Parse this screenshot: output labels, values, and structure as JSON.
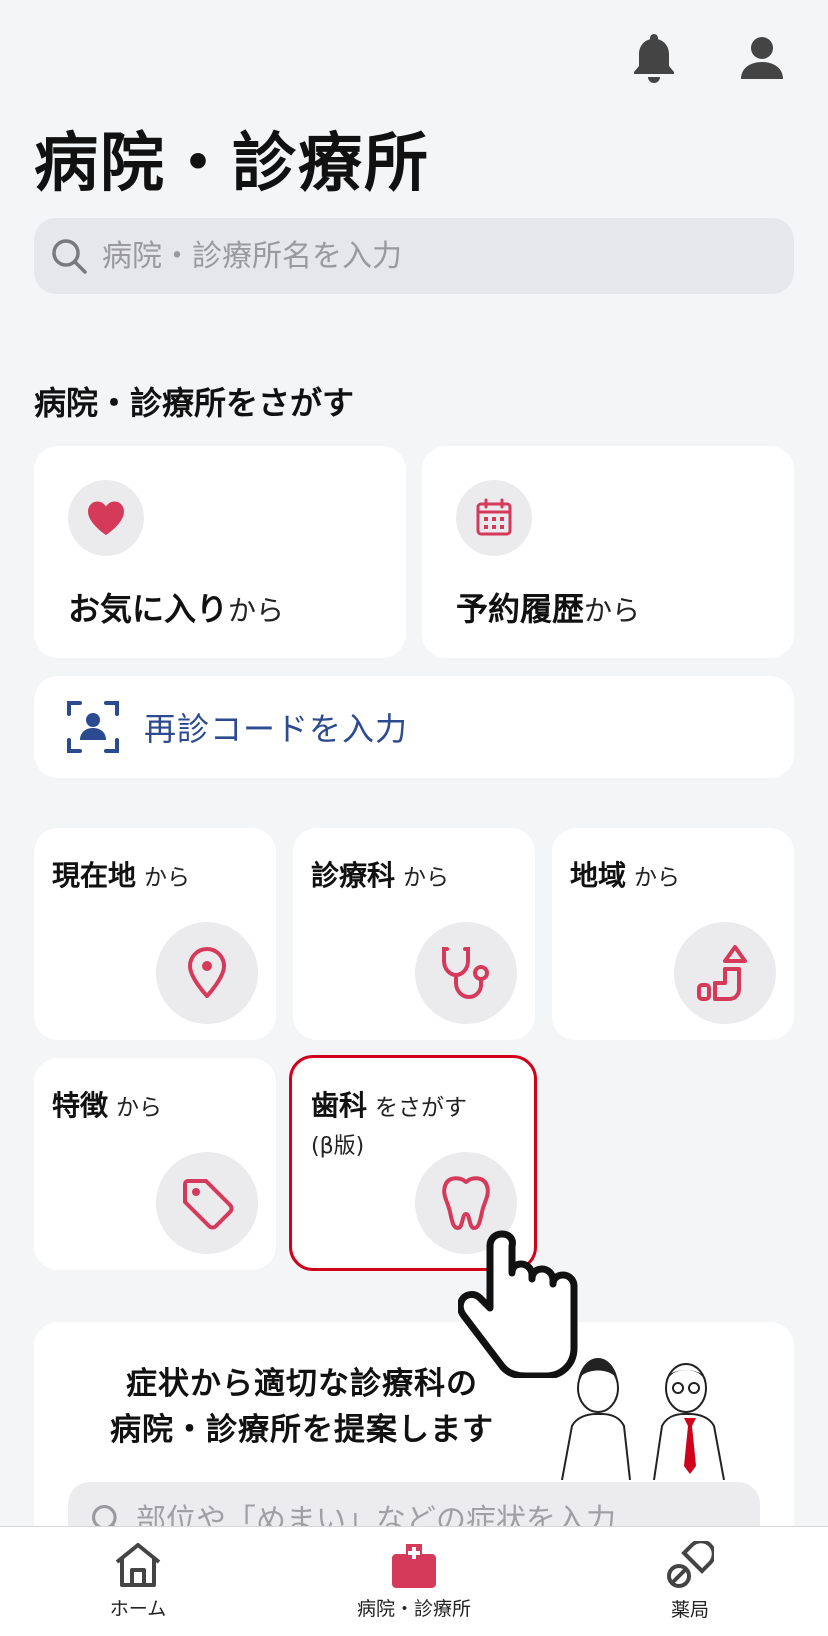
{
  "header": {
    "bell_icon": "bell-icon",
    "account_icon": "user-icon"
  },
  "page": {
    "title": "病院・診療所"
  },
  "search": {
    "placeholder": "病院・診療所名を入力"
  },
  "find_section": {
    "title": "病院・診療所をさがす",
    "favorites": {
      "strong": "お気に入り",
      "suffix": "から",
      "icon": "heart-icon"
    },
    "history": {
      "strong": "予約履歴",
      "suffix": "から",
      "icon": "calendar-icon"
    },
    "revisit": {
      "label": "再診コードを入力",
      "icon": "user-scan-icon"
    },
    "tiles": [
      {
        "strong": "現在地",
        "suffix": "から",
        "icon": "location-pin-icon"
      },
      {
        "strong": "診療科",
        "suffix": "から",
        "icon": "stethoscope-icon"
      },
      {
        "strong": "地域",
        "suffix": "から",
        "icon": "map-region-icon"
      },
      {
        "strong": "特徴",
        "suffix": "から",
        "icon": "tag-icon"
      },
      {
        "strong": "歯科",
        "suffix": "をさがす",
        "note": "(β版)",
        "icon": "tooth-icon"
      }
    ]
  },
  "suggest": {
    "line1": "症状から適切な診療科の",
    "line2": "病院・診療所を提案します",
    "placeholder": "部位や「めまい」などの症状を入力"
  },
  "bottom_nav": [
    {
      "label": "ホーム",
      "icon": "home-icon",
      "active": false
    },
    {
      "label": "病院・診療所",
      "icon": "hospital-icon",
      "active": true
    },
    {
      "label": "薬局",
      "icon": "pill-icon",
      "active": false
    }
  ],
  "colors": {
    "accent": "#d63a5b",
    "link": "#2b4a8f",
    "highlight": "#d0021b"
  }
}
